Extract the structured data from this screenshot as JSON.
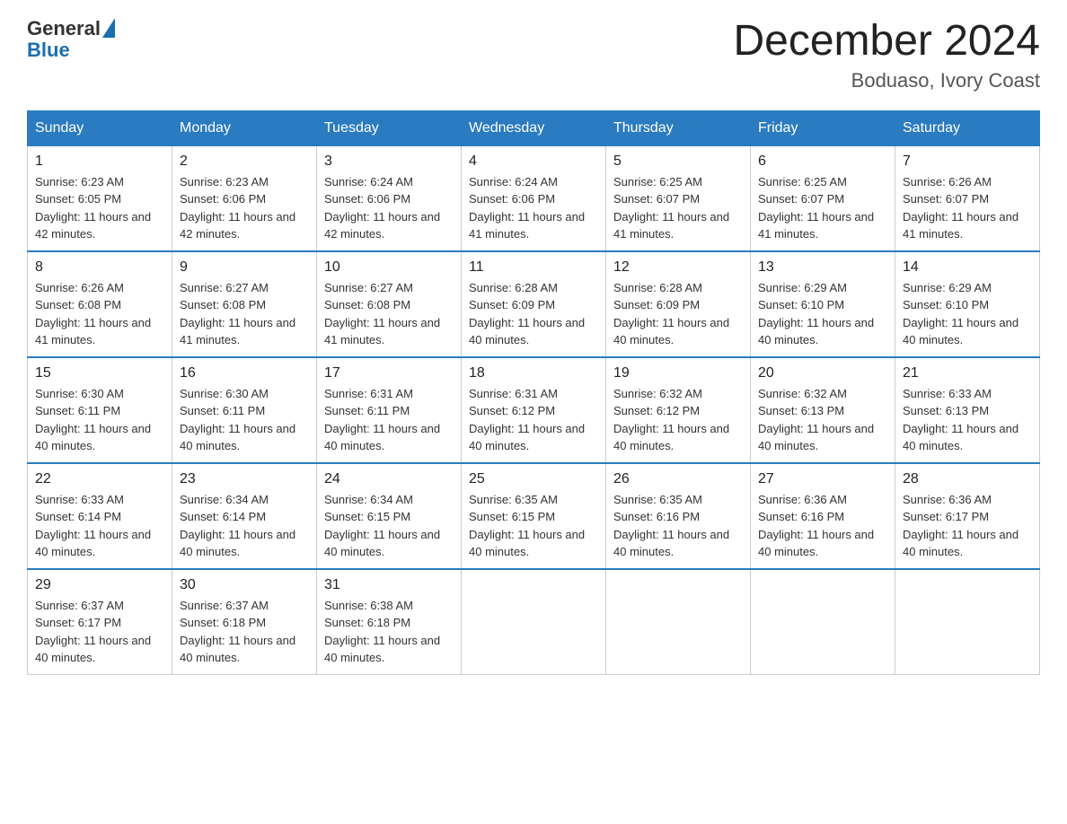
{
  "logo": {
    "general": "General",
    "blue": "Blue"
  },
  "title": "December 2024",
  "location": "Boduaso, Ivory Coast",
  "days_of_week": [
    "Sunday",
    "Monday",
    "Tuesday",
    "Wednesday",
    "Thursday",
    "Friday",
    "Saturday"
  ],
  "weeks": [
    [
      {
        "num": "1",
        "sunrise": "6:23 AM",
        "sunset": "6:05 PM",
        "daylight": "11 hours and 42 minutes."
      },
      {
        "num": "2",
        "sunrise": "6:23 AM",
        "sunset": "6:06 PM",
        "daylight": "11 hours and 42 minutes."
      },
      {
        "num": "3",
        "sunrise": "6:24 AM",
        "sunset": "6:06 PM",
        "daylight": "11 hours and 42 minutes."
      },
      {
        "num": "4",
        "sunrise": "6:24 AM",
        "sunset": "6:06 PM",
        "daylight": "11 hours and 41 minutes."
      },
      {
        "num": "5",
        "sunrise": "6:25 AM",
        "sunset": "6:07 PM",
        "daylight": "11 hours and 41 minutes."
      },
      {
        "num": "6",
        "sunrise": "6:25 AM",
        "sunset": "6:07 PM",
        "daylight": "11 hours and 41 minutes."
      },
      {
        "num": "7",
        "sunrise": "6:26 AM",
        "sunset": "6:07 PM",
        "daylight": "11 hours and 41 minutes."
      }
    ],
    [
      {
        "num": "8",
        "sunrise": "6:26 AM",
        "sunset": "6:08 PM",
        "daylight": "11 hours and 41 minutes."
      },
      {
        "num": "9",
        "sunrise": "6:27 AM",
        "sunset": "6:08 PM",
        "daylight": "11 hours and 41 minutes."
      },
      {
        "num": "10",
        "sunrise": "6:27 AM",
        "sunset": "6:08 PM",
        "daylight": "11 hours and 41 minutes."
      },
      {
        "num": "11",
        "sunrise": "6:28 AM",
        "sunset": "6:09 PM",
        "daylight": "11 hours and 40 minutes."
      },
      {
        "num": "12",
        "sunrise": "6:28 AM",
        "sunset": "6:09 PM",
        "daylight": "11 hours and 40 minutes."
      },
      {
        "num": "13",
        "sunrise": "6:29 AM",
        "sunset": "6:10 PM",
        "daylight": "11 hours and 40 minutes."
      },
      {
        "num": "14",
        "sunrise": "6:29 AM",
        "sunset": "6:10 PM",
        "daylight": "11 hours and 40 minutes."
      }
    ],
    [
      {
        "num": "15",
        "sunrise": "6:30 AM",
        "sunset": "6:11 PM",
        "daylight": "11 hours and 40 minutes."
      },
      {
        "num": "16",
        "sunrise": "6:30 AM",
        "sunset": "6:11 PM",
        "daylight": "11 hours and 40 minutes."
      },
      {
        "num": "17",
        "sunrise": "6:31 AM",
        "sunset": "6:11 PM",
        "daylight": "11 hours and 40 minutes."
      },
      {
        "num": "18",
        "sunrise": "6:31 AM",
        "sunset": "6:12 PM",
        "daylight": "11 hours and 40 minutes."
      },
      {
        "num": "19",
        "sunrise": "6:32 AM",
        "sunset": "6:12 PM",
        "daylight": "11 hours and 40 minutes."
      },
      {
        "num": "20",
        "sunrise": "6:32 AM",
        "sunset": "6:13 PM",
        "daylight": "11 hours and 40 minutes."
      },
      {
        "num": "21",
        "sunrise": "6:33 AM",
        "sunset": "6:13 PM",
        "daylight": "11 hours and 40 minutes."
      }
    ],
    [
      {
        "num": "22",
        "sunrise": "6:33 AM",
        "sunset": "6:14 PM",
        "daylight": "11 hours and 40 minutes."
      },
      {
        "num": "23",
        "sunrise": "6:34 AM",
        "sunset": "6:14 PM",
        "daylight": "11 hours and 40 minutes."
      },
      {
        "num": "24",
        "sunrise": "6:34 AM",
        "sunset": "6:15 PM",
        "daylight": "11 hours and 40 minutes."
      },
      {
        "num": "25",
        "sunrise": "6:35 AM",
        "sunset": "6:15 PM",
        "daylight": "11 hours and 40 minutes."
      },
      {
        "num": "26",
        "sunrise": "6:35 AM",
        "sunset": "6:16 PM",
        "daylight": "11 hours and 40 minutes."
      },
      {
        "num": "27",
        "sunrise": "6:36 AM",
        "sunset": "6:16 PM",
        "daylight": "11 hours and 40 minutes."
      },
      {
        "num": "28",
        "sunrise": "6:36 AM",
        "sunset": "6:17 PM",
        "daylight": "11 hours and 40 minutes."
      }
    ],
    [
      {
        "num": "29",
        "sunrise": "6:37 AM",
        "sunset": "6:17 PM",
        "daylight": "11 hours and 40 minutes."
      },
      {
        "num": "30",
        "sunrise": "6:37 AM",
        "sunset": "6:18 PM",
        "daylight": "11 hours and 40 minutes."
      },
      {
        "num": "31",
        "sunrise": "6:38 AM",
        "sunset": "6:18 PM",
        "daylight": "11 hours and 40 minutes."
      },
      null,
      null,
      null,
      null
    ]
  ],
  "labels": {
    "sunrise": "Sunrise:",
    "sunset": "Sunset:",
    "daylight": "Daylight:"
  }
}
